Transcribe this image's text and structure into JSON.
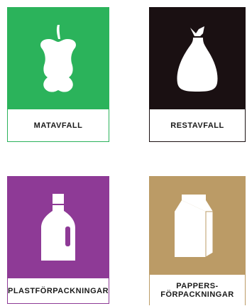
{
  "cards": {
    "matavfall": {
      "label": "MATAVFALL",
      "color": "#2bb35b",
      "icon": "apple-core-icon"
    },
    "restavfall": {
      "label": "RESTAVFALL",
      "color": "#1a1012",
      "icon": "trash-bag-icon"
    },
    "plast": {
      "label": "PLASTFÖRPACKNINGAR",
      "color": "#8e3a96",
      "icon": "plastic-bottle-icon"
    },
    "papper": {
      "label_line1": "PAPPERS-",
      "label_line2": "FÖRPACKNINGAR",
      "color": "#bb9b66",
      "icon": "milk-carton-icon"
    }
  }
}
